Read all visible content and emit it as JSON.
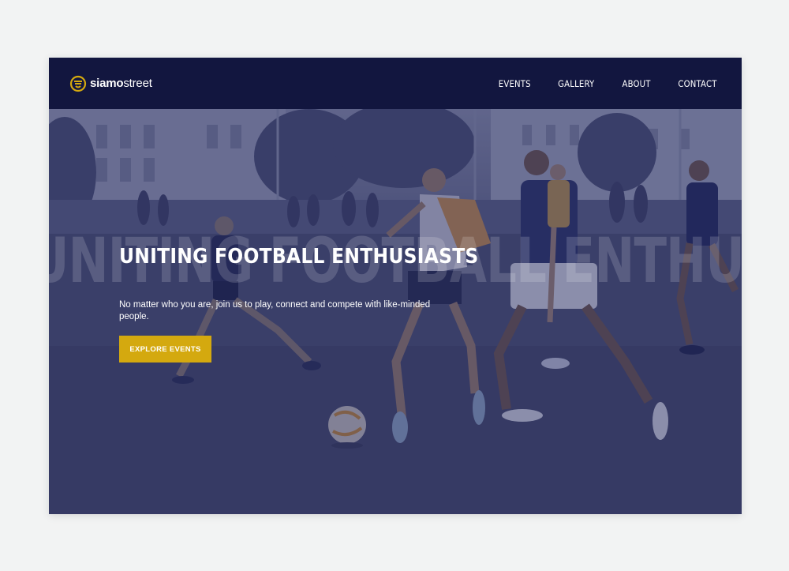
{
  "brand": {
    "name_bold": "siamo",
    "name_light": "street",
    "accent_color": "#d4a90f",
    "nav_bg": "#12163f"
  },
  "nav": {
    "items": [
      {
        "label": "EVENTS"
      },
      {
        "label": "GALLERY"
      },
      {
        "label": "ABOUT"
      },
      {
        "label": "CONTACT"
      }
    ]
  },
  "hero": {
    "watermark": "UNITING FOOTBALL ENTHUSIASTS",
    "title": "UNITING FOOTBALL ENTHUSIASTS",
    "subtitle": "No matter who you are, join us to play, connect and compete with like-minded people.",
    "cta_label": "EXPLORE EVENTS",
    "image_icon": "football-players-photo"
  }
}
